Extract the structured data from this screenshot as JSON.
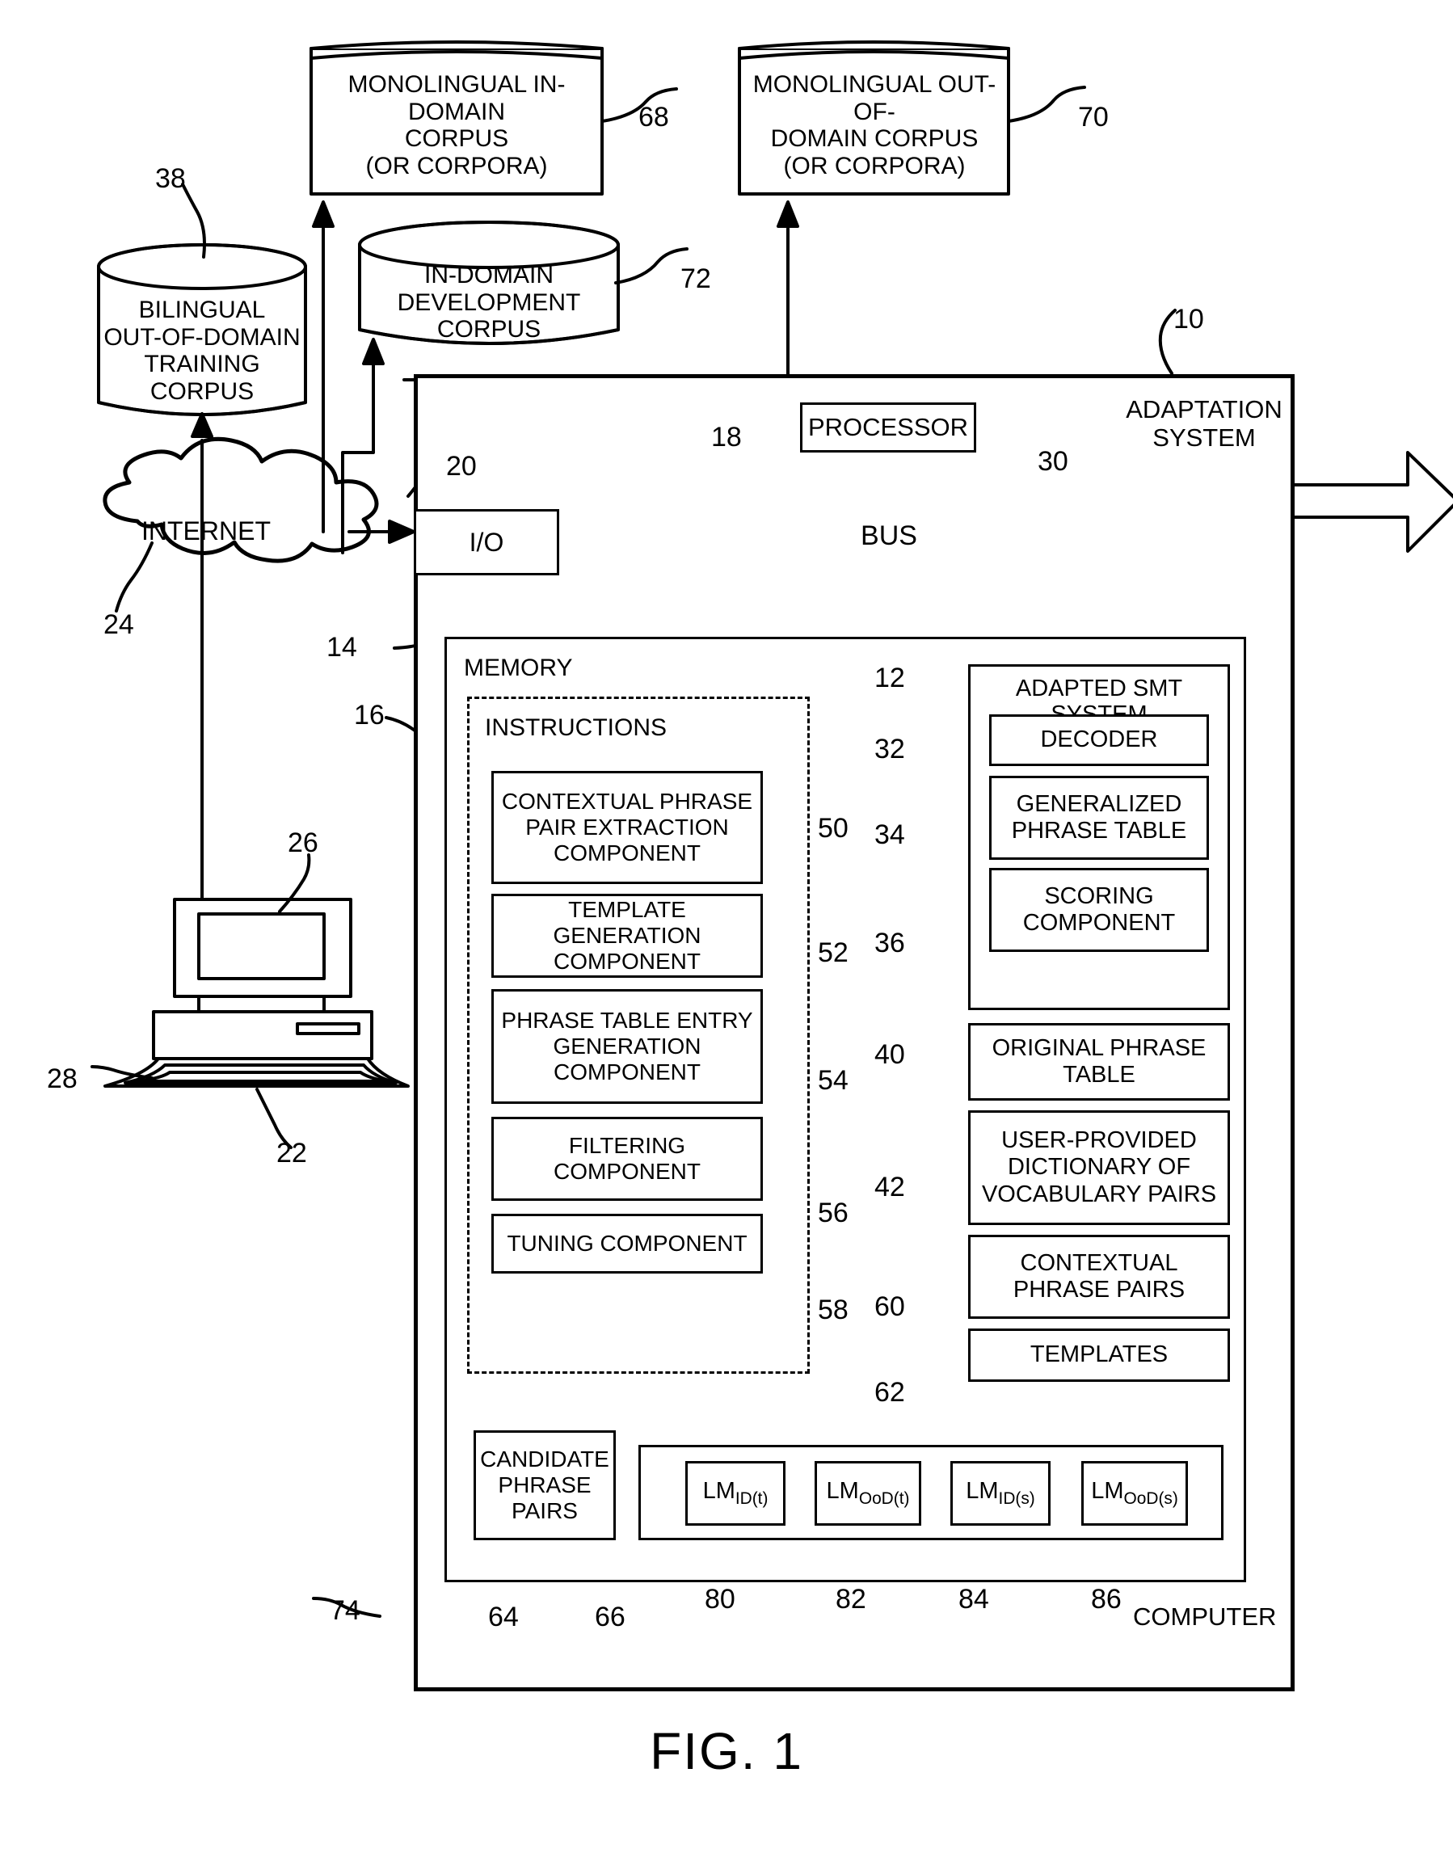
{
  "figure": {
    "caption": "FIG. 1",
    "title_label": "ADAPTATION SYSTEM"
  },
  "data_stores": {
    "monolingual_in_domain": {
      "label": "MONOLINGUAL IN-DOMAIN\nCORPUS\n(OR CORPORA)",
      "ref": "68"
    },
    "monolingual_out_of_domain": {
      "label": "MONOLINGUAL OUT-OF-\nDOMAIN CORPUS\n(OR CORPORA)",
      "ref": "70"
    },
    "in_domain_development": {
      "label": "IN-DOMAIN\nDEVELOPMENT CORPUS",
      "ref": "72"
    },
    "bilingual_out_of_domain": {
      "label": "BILINGUAL\nOUT-OF-DOMAIN\nTRAINING CORPUS",
      "ref": "38"
    }
  },
  "network": {
    "internet_label": "INTERNET",
    "internet_ref": "24",
    "client_ref": "22",
    "display_ref": "26",
    "keyboard_ref": "28"
  },
  "system": {
    "ref": "10",
    "computer_label": "COMPUTER",
    "computer_ref": "74",
    "io": {
      "label": "I/O",
      "ref": "20"
    },
    "processor": {
      "label": "PROCESSOR",
      "ref": "18"
    },
    "bus": {
      "label": "BUS",
      "ref": "30"
    },
    "memory": {
      "label": "MEMORY",
      "ref": "14"
    },
    "instructions": {
      "label": "INSTRUCTIONS",
      "ref": "16"
    }
  },
  "instruction_components": [
    {
      "label": "CONTEXTUAL PHRASE\nPAIR EXTRACTION\nCOMPONENT",
      "ref": "50"
    },
    {
      "label": "TEMPLATE GENERATION\nCOMPONENT",
      "ref": "52"
    },
    {
      "label": "PHRASE TABLE ENTRY\nGENERATION\nCOMPONENT",
      "ref": "54"
    },
    {
      "label": "FILTERING\nCOMPONENT",
      "ref": "56"
    },
    {
      "label": "TUNING COMPONENT",
      "ref": "58"
    }
  ],
  "smt_system": {
    "label": "ADAPTED SMT SYSTEM",
    "ref": "12",
    "children": [
      {
        "label": "DECODER",
        "ref": "32"
      },
      {
        "label": "GENERALIZED\nPHRASE TABLE",
        "ref": "34"
      },
      {
        "label": "SCORING\nCOMPONENT",
        "ref": "36"
      }
    ]
  },
  "memory_data": [
    {
      "label": "ORIGINAL\nPHRASE TABLE",
      "ref": "40"
    },
    {
      "label": "USER-PROVIDED\nDICTIONARY OF\nVOCABULARY PAIRS",
      "ref": "42"
    },
    {
      "label": "CONTEXTUAL\nPHRASE PAIRS",
      "ref": "60"
    },
    {
      "label": "TEMPLATES",
      "ref": "62"
    }
  ],
  "candidate_phrase_pairs": {
    "label": "CANDIDATE\nPHRASE\nPAIRS",
    "ref": "64"
  },
  "language_models": {
    "container_ref": "66",
    "items": [
      {
        "base": "LM",
        "subscript": "ID(t)",
        "ref": "80"
      },
      {
        "base": "LM",
        "subscript": "OoD(t)",
        "ref": "82"
      },
      {
        "base": "LM",
        "subscript": "ID(s)",
        "ref": "84"
      },
      {
        "base": "LM",
        "subscript": "OoD(s)",
        "ref": "86"
      }
    ]
  },
  "colors": {
    "ink": "#000000",
    "paper": "#ffffff"
  }
}
